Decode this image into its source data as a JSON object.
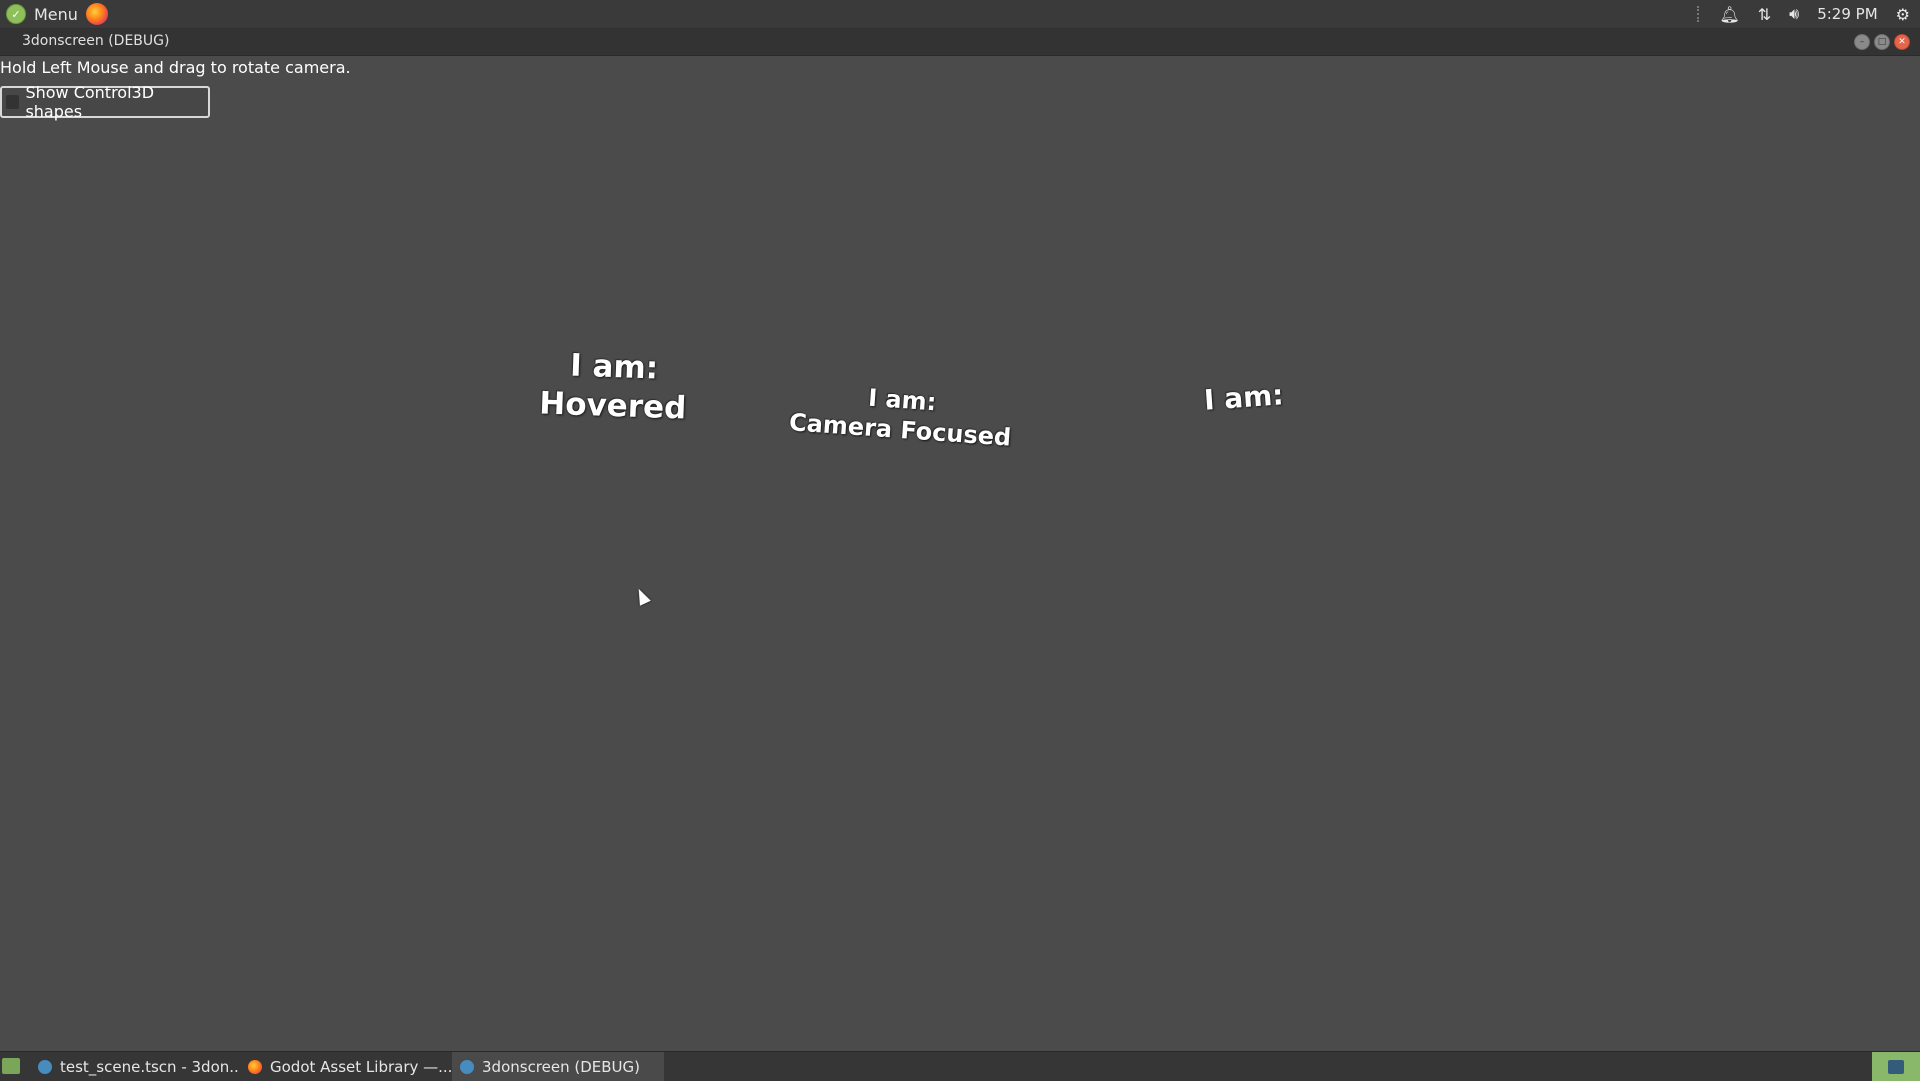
{
  "panel": {
    "menu_label": "Menu",
    "clock": "5:29 PM",
    "icons": [
      "mint-logo-icon",
      "firefox-icon",
      "bell-icon",
      "network-icon",
      "volume-icon",
      "settings-icon"
    ]
  },
  "window": {
    "title": "3donscreen (DEBUG)"
  },
  "app": {
    "hint": "Hold Left Mouse and drag to rotate camera.",
    "checkbox_label": "Show Control3D shapes",
    "checkbox_checked": false,
    "labels": [
      {
        "line1": "I am:",
        "line2": "Hovered"
      },
      {
        "line1": "I am:",
        "line2": "Camera Focused"
      },
      {
        "line1": "I am:",
        "line2": ""
      }
    ]
  },
  "taskbar": {
    "tasks": [
      {
        "label": "test_scene.tscn - 3don...",
        "icon": "godot-icon",
        "active": false
      },
      {
        "label": "Godot Asset Library —...",
        "icon": "firefox-icon",
        "active": false
      },
      {
        "label": "3donscreen (DEBUG)",
        "icon": "godot-icon",
        "active": true
      }
    ]
  }
}
